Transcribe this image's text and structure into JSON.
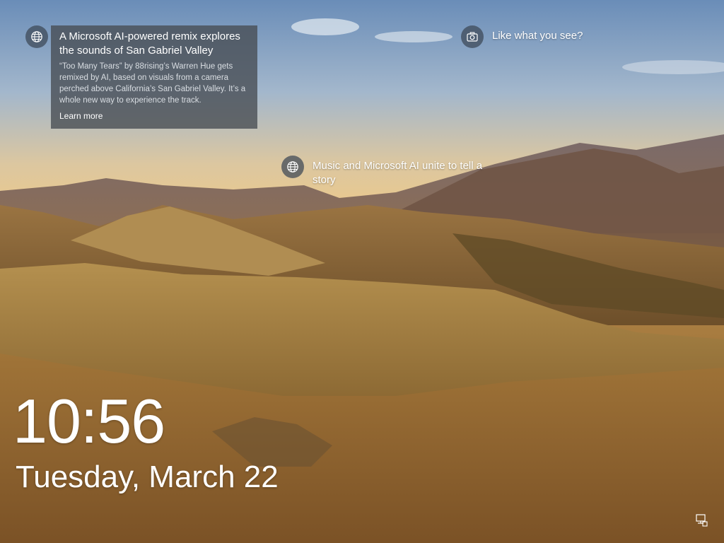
{
  "clock": {
    "time": "10:56",
    "date": "Tuesday, March 22"
  },
  "spotlight": {
    "card": {
      "title": "A Microsoft AI-powered remix explores the sounds of San Gabriel Valley",
      "body": "“Too Many Tears” by 88rising’s Warren Hue gets remixed by AI, based on visuals from a camera perched above California’s San Gabriel Valley. It’s a whole new way to experience the track.",
      "link": "Learn more",
      "icon": "globe-icon"
    },
    "like_prompt": {
      "label": "Like what you see?",
      "icon": "camera-icon"
    },
    "story_hotspot": {
      "label": "Music and Microsoft AI unite to tell a story",
      "icon": "globe-icon"
    }
  },
  "system_tray": {
    "network_icon": "network-icon"
  },
  "colors": {
    "card_background": "#464b52",
    "text": "#ffffff",
    "icon_background": "#3c4655"
  }
}
